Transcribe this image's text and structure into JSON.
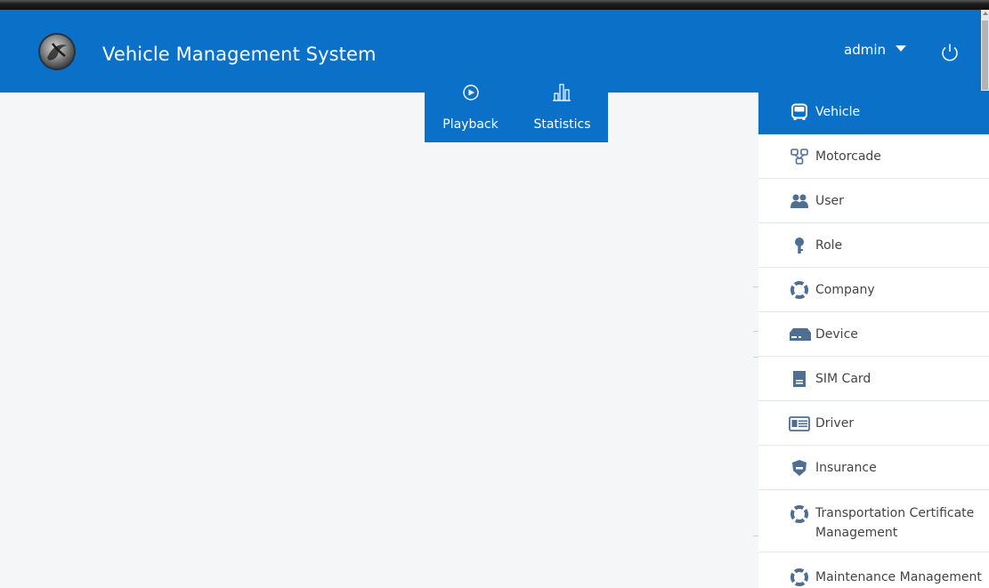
{
  "header": {
    "title": "Vehicle Management System",
    "user": "admin",
    "brand_color": "#0b71c8",
    "logo_icon": "globe-logo-icon",
    "power_icon": "power-icon"
  },
  "nav_tabs": [
    {
      "label": "Playback",
      "icon": "play-circle-icon"
    },
    {
      "label": "Statistics",
      "icon": "bar-chart-icon"
    }
  ],
  "side_menu": {
    "items": [
      {
        "label": "Vehicle",
        "icon": "bus-icon",
        "active": true
      },
      {
        "label": "Motorcade",
        "icon": "motorcade-icon"
      },
      {
        "label": "User",
        "icon": "users-icon"
      },
      {
        "label": "Role",
        "icon": "key-icon"
      },
      {
        "label": "Company",
        "icon": "lifebuoy-icon"
      },
      {
        "label": "Device",
        "icon": "device-icon"
      },
      {
        "label": "SIM Card",
        "icon": "sim-card-icon"
      },
      {
        "label": "Driver",
        "icon": "id-card-icon"
      },
      {
        "label": "Insurance",
        "icon": "shield-icon"
      },
      {
        "label": "Transportation Certificate Management",
        "icon": "lifebuoy-icon"
      },
      {
        "label": "Maintenance Management",
        "icon": "lifebuoy-icon"
      }
    ]
  }
}
